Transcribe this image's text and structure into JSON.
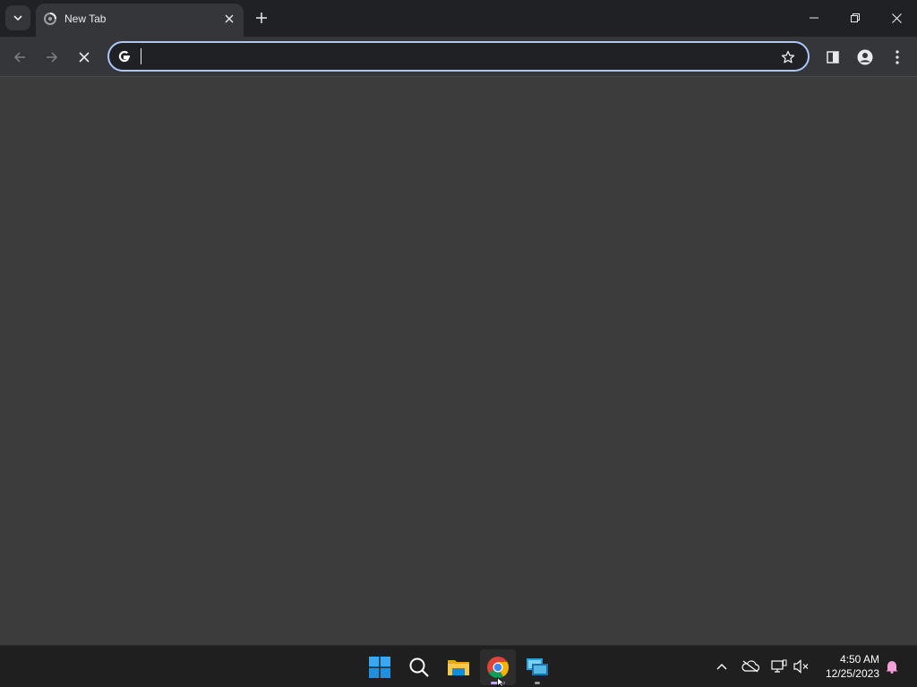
{
  "browser": {
    "tab": {
      "title": "New Tab"
    },
    "omnibox": {
      "value": "",
      "placeholder": ""
    },
    "icons": {
      "tab_search": "chevron-down-icon",
      "favicon": "loading-icon",
      "close_tab": "close-icon",
      "new_tab": "plus-icon",
      "back": "arrow-left-icon",
      "forward": "arrow-right-icon",
      "stop": "stop-icon",
      "search_engine": "google-icon",
      "bookmark": "star-icon",
      "side_panel": "side-panel-icon",
      "profile": "profile-icon",
      "menu": "kebab-menu-icon",
      "minimize": "minimize-icon",
      "restore": "restore-icon",
      "close_window": "close-icon"
    },
    "colors": {
      "titlebar": "#202124",
      "toolbar": "#35363a",
      "page": "#3c3c3c",
      "omnibox_focus": "#a8c7fa"
    }
  },
  "taskbar": {
    "apps": [
      {
        "name": "Start",
        "icon": "windows-start-icon"
      },
      {
        "name": "Search",
        "icon": "search-icon"
      },
      {
        "name": "File Explorer",
        "icon": "folder-icon"
      },
      {
        "name": "Google Chrome",
        "icon": "chrome-icon",
        "active": true
      },
      {
        "name": "Remote Desktop",
        "icon": "remote-desktop-icon"
      }
    ],
    "tray": {
      "icons": [
        "chevron-up-icon",
        "onedrive-off-icon",
        "network-icon",
        "volume-muted-icon",
        "notification-bell-icon"
      ]
    },
    "clock": {
      "time": "4:50 AM",
      "date": "12/25/2023"
    }
  }
}
